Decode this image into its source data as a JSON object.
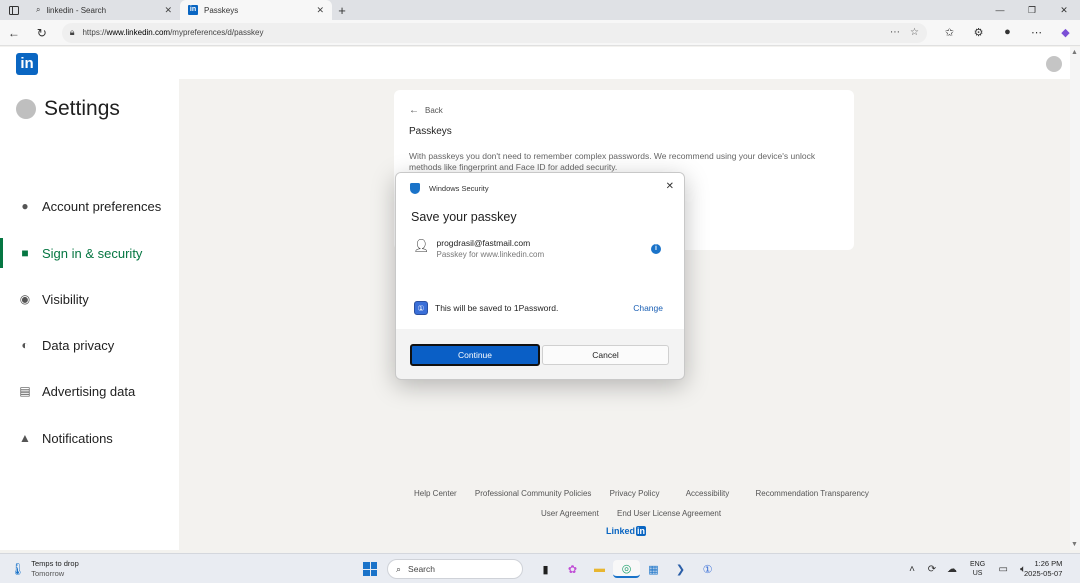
{
  "browser": {
    "tabs": [
      {
        "title": "linkedin - Search",
        "icon": "search-icon"
      },
      {
        "title": "Passkeys",
        "icon": "linkedin-icon"
      }
    ],
    "url_prefix": "https://",
    "url_host": "www.linkedin.com",
    "url_path": "/mypreferences/d/passkey"
  },
  "linkedin": {
    "logo_text": "in"
  },
  "sidebar": {
    "title": "Settings",
    "items": [
      {
        "label": "Account preferences",
        "icon": "person-icon"
      },
      {
        "label": "Sign in & security",
        "icon": "lock-icon",
        "active": true
      },
      {
        "label": "Visibility",
        "icon": "eye-icon"
      },
      {
        "label": "Data privacy",
        "icon": "shield-icon"
      },
      {
        "label": "Advertising data",
        "icon": "newspaper-icon"
      },
      {
        "label": "Notifications",
        "icon": "bell-icon"
      }
    ]
  },
  "content": {
    "back_label": "Back",
    "title": "Passkeys",
    "description": "With passkeys you don't need to remember complex passwords. We recommend using your device's unlock methods like fingerprint and Face ID for added security."
  },
  "dialog": {
    "header": "Windows Security",
    "title": "Save your passkey",
    "account_email": "progdrasil@fastmail.com",
    "account_sub": "Passkey for www.linkedin.com",
    "save_to_text": "This will be saved to 1Password.",
    "change_label": "Change",
    "continue_label": "Continue",
    "cancel_label": "Cancel"
  },
  "footer": {
    "row1": [
      "Help Center",
      "Professional Community Policies",
      "Privacy Policy",
      "Accessibility",
      "Recommendation Transparency"
    ],
    "row2": [
      "User Agreement",
      "End User License Agreement"
    ],
    "brand": "Linked",
    "brand_in": "in"
  },
  "taskbar": {
    "weather_line1": "Temps to drop",
    "weather_line2": "Tomorrow",
    "search_placeholder": "Search",
    "lang_line1": "ENG",
    "lang_line2": "US",
    "time": "1:26 PM",
    "date": "2025-05-07"
  },
  "colors": {
    "linkedin_blue": "#0a66c2",
    "active_green": "#057642",
    "windows_blue": "#0a5fc6"
  }
}
